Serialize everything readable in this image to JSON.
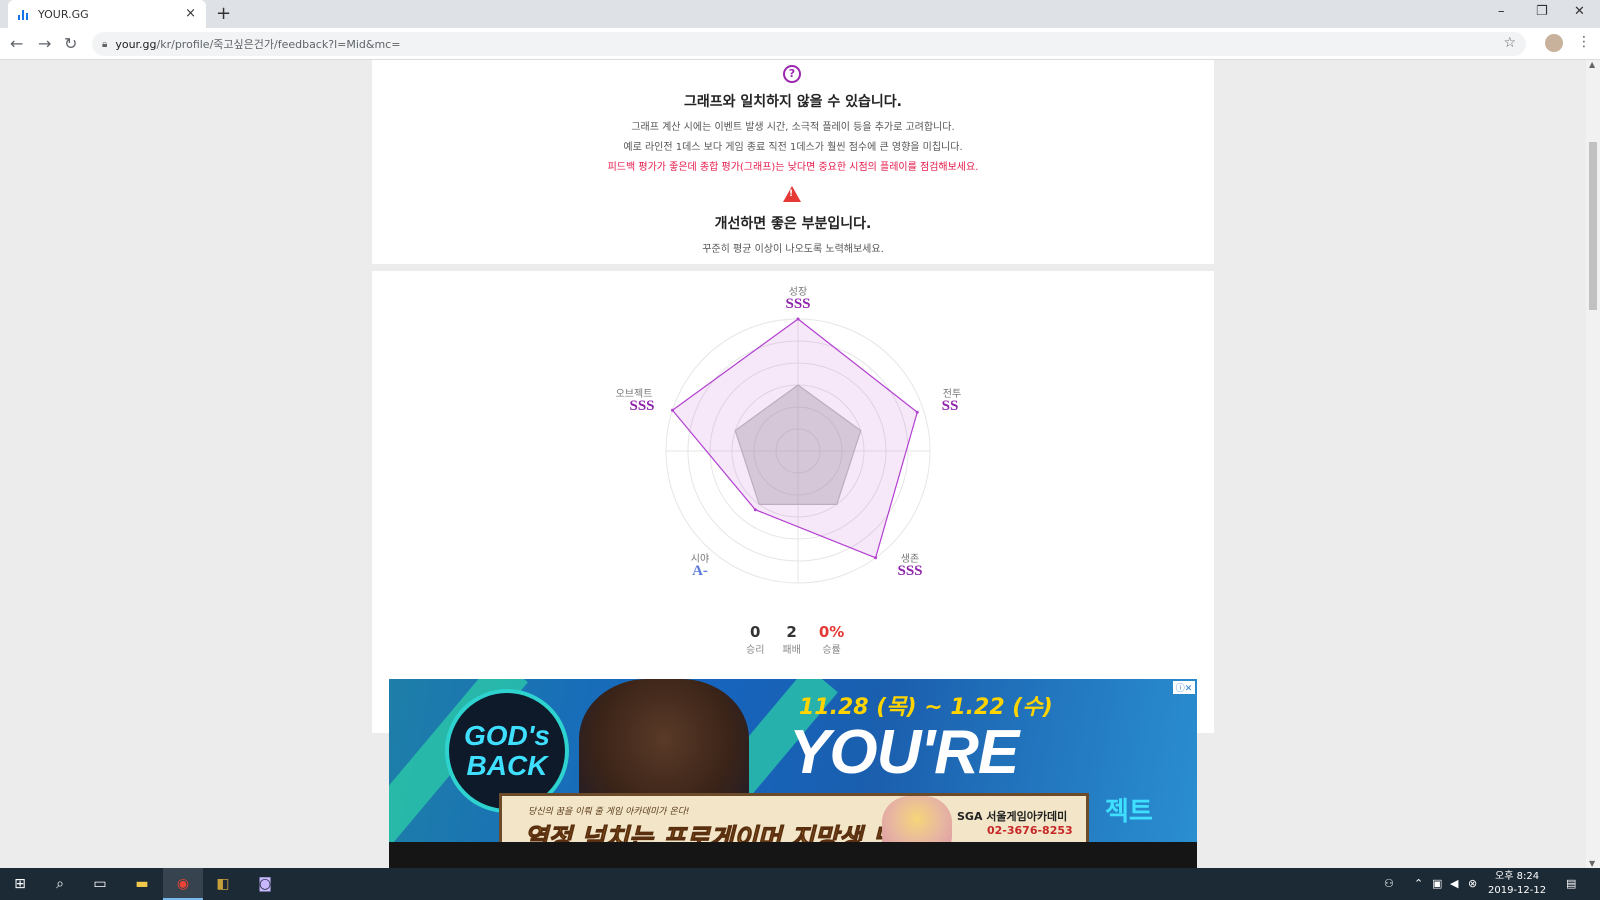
{
  "browser": {
    "tab_title": "YOUR.GG",
    "tab_close": "×",
    "new_tab": "+",
    "url_host": "your.gg",
    "url_path": "/kr/profile/죽고싶은건가/feedback?l=Mid&mc=",
    "window_min": "–",
    "window_restore": "❐",
    "window_close": "✕"
  },
  "feedback": {
    "help_icon_glyph": "?",
    "title1": "그래프와 일치하지 않을 수 있습니다.",
    "line1": "그래프 계산 시에는 이벤트 발생 시간, 소극적 플레이 등을 추가로 고려합니다.",
    "line2": "예로 라인전 1데스 보다 게임 종료 직전 1데스가 훨씬 점수에 큰 영향을 미칩니다.",
    "line3": "피드백 평가가 좋은데 종합 평가(그래프)는 낮다면 중요한 시점의 플레이를 점검해보세요.",
    "warn_icon_glyph": "!",
    "title2": "개선하면 좋은 부분입니다.",
    "line4": "꾸준히 평균 이상이 나오도록 노력해보세요."
  },
  "radar": {
    "axes": [
      {
        "label": "성장",
        "grade": "SSS"
      },
      {
        "label": "전투",
        "grade": "SS"
      },
      {
        "label": "생존",
        "grade": "SSS"
      },
      {
        "label": "시야",
        "grade": "A-"
      },
      {
        "label": "오브젝트",
        "grade": "SSS"
      }
    ],
    "player_values": [
      1.0,
      0.95,
      1.0,
      0.55,
      1.0
    ],
    "average_values": [
      0.5,
      0.5,
      0.5,
      0.5,
      0.5
    ],
    "colors": {
      "player": "#b23fd0",
      "average": "#9e9e9e",
      "grade": "#8e24aa",
      "grade_low": "#5c7bd9"
    }
  },
  "stats": {
    "wins": "0",
    "wins_label": "승리",
    "losses": "2",
    "losses_label": "패배",
    "winrate": "0%",
    "winrate_label": "승률"
  },
  "ad": {
    "circle_text": "GOD's BACK",
    "date": "11.28 (목) ~ 1.22 (수)",
    "headline": "YOU'RE BACK",
    "side_text": "젝트",
    "sub_small": "당신의 꿈을 이뤄 줄 게임 아카데미가 온다!",
    "sub_big": "열정 넘치는 프로게이머 지망생 모집!",
    "sub_brand": "SGA 서울게임아카데미",
    "sub_phone": "02-3676-8253",
    "ad_badge": "ⓘ✕"
  },
  "taskbar": {
    "time": "오후 8:24",
    "date": "2019-12-12"
  }
}
